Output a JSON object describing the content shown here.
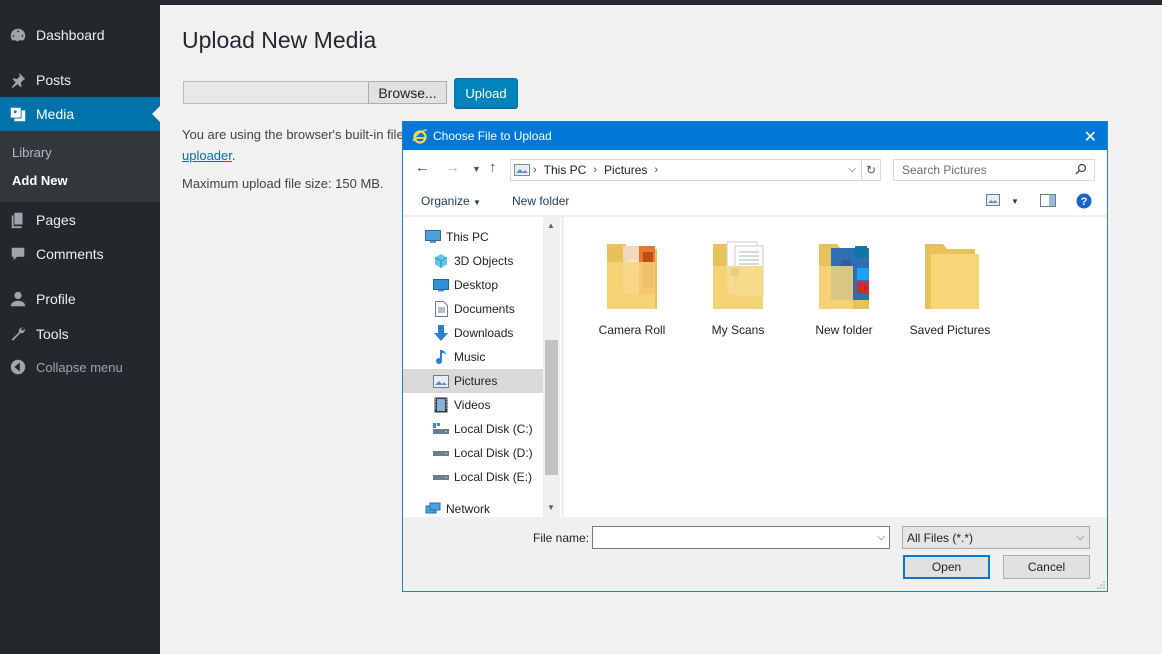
{
  "sidebar": {
    "items": [
      {
        "label": "Dashboard",
        "icon": "dashboard-icon"
      },
      {
        "label": "Posts",
        "icon": "pin-icon"
      },
      {
        "label": "Media",
        "icon": "media-icon",
        "active": true
      },
      {
        "label": "Pages",
        "icon": "pages-icon"
      },
      {
        "label": "Comments",
        "icon": "comment-icon"
      },
      {
        "label": "Profile",
        "icon": "user-icon"
      },
      {
        "label": "Tools",
        "icon": "wrench-icon"
      },
      {
        "label": "Collapse menu",
        "icon": "collapse-icon"
      }
    ],
    "submenu": [
      {
        "label": "Library"
      },
      {
        "label": "Add New",
        "current": true
      }
    ]
  },
  "main": {
    "title": "Upload New Media",
    "browse_label": "Browse...",
    "upload_label": "Upload",
    "notice_text": "You are using the browser's built-in file",
    "notice_link": "uploader",
    "notice_end": ".",
    "max_size": "Maximum upload file size: 150 MB."
  },
  "dialog": {
    "title": "Choose File to Upload",
    "address": [
      "This PC",
      "Pictures"
    ],
    "search_placeholder": "Search Pictures",
    "organize_label": "Organize",
    "new_folder_label": "New folder",
    "tree": [
      {
        "label": "This PC",
        "icon": "computer-icon",
        "indent": 0
      },
      {
        "label": "3D Objects",
        "icon": "cube-icon",
        "indent": 1
      },
      {
        "label": "Desktop",
        "icon": "desktop-icon",
        "indent": 1
      },
      {
        "label": "Documents",
        "icon": "document-icon",
        "indent": 1
      },
      {
        "label": "Downloads",
        "icon": "download-icon",
        "indent": 1
      },
      {
        "label": "Music",
        "icon": "music-icon",
        "indent": 1
      },
      {
        "label": "Pictures",
        "icon": "pictures-icon",
        "indent": 1,
        "selected": true
      },
      {
        "label": "Videos",
        "icon": "video-icon",
        "indent": 1
      },
      {
        "label": "Local Disk (C:)",
        "icon": "disk-icon",
        "indent": 1
      },
      {
        "label": "Local Disk (D:)",
        "icon": "disk-icon",
        "indent": 1
      },
      {
        "label": "Local Disk (E:)",
        "icon": "disk-icon",
        "indent": 1
      },
      {
        "label": "Network",
        "icon": "network-icon",
        "indent": 0
      }
    ],
    "files": [
      {
        "label": "Camera Roll"
      },
      {
        "label": "My Scans"
      },
      {
        "label": "New folder"
      },
      {
        "label": "Saved Pictures"
      }
    ],
    "file_name_label": "File name:",
    "file_name_value": "",
    "file_type": "All Files (*.*)",
    "open_label": "Open",
    "cancel_label": "Cancel"
  },
  "colors": {
    "sidebar_bg": "#23282d",
    "accent": "#0073aa",
    "dialog_title": "#0078d7"
  }
}
